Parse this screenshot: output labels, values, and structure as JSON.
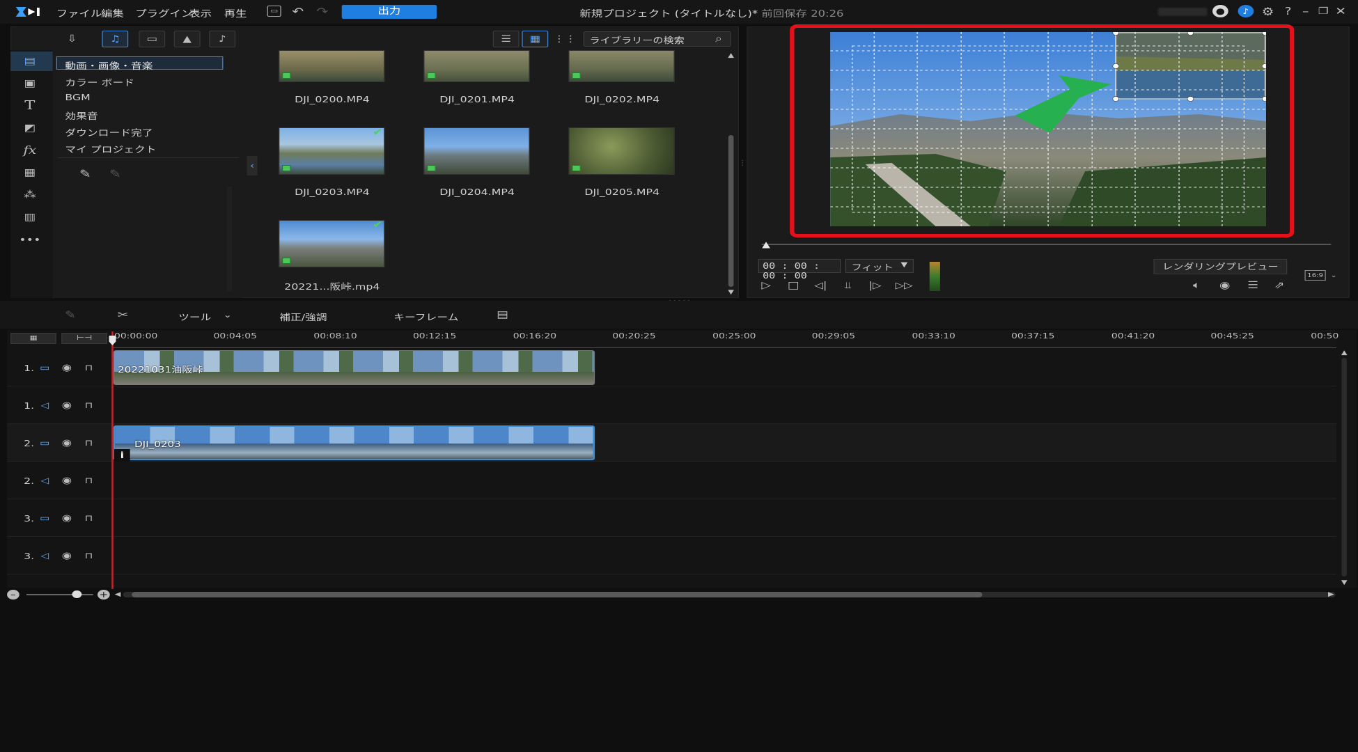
{
  "app": {
    "logo": "cyberlink-logo",
    "title": "新規プロジェクト (タイトルなし)*",
    "saved": "前回保存 20:26",
    "export": "出力"
  },
  "menu": [
    "ファイル",
    "編集",
    "プラグイン",
    "表示",
    "再生"
  ],
  "library": {
    "categories": [
      "動画・画像・音楽",
      "カラー ボード",
      "BGM",
      "効果音",
      "ダウンロード完了",
      "マイ プロジェクト"
    ],
    "search_placeholder": "ライブラリーの検索",
    "items": [
      {
        "name": "DJI_0200.MP4",
        "checked": false
      },
      {
        "name": "DJI_0201.MP4",
        "checked": false
      },
      {
        "name": "DJI_0202.MP4",
        "checked": false
      },
      {
        "name": "DJI_0203.MP4",
        "checked": true
      },
      {
        "name": "DJI_0204.MP4",
        "checked": false
      },
      {
        "name": "DJI_0205.MP4",
        "checked": false
      },
      {
        "name": "20221...阪峠.mp4",
        "checked": true
      }
    ]
  },
  "preview": {
    "timecode": "00 : 00 : 00 : 00",
    "zoom": "フィット",
    "render": "レンダリングプレビュー",
    "aspect": "16:9"
  },
  "edit_toolbar": {
    "tools": "ツール",
    "correct": "補正/強調",
    "keyframe": "キーフレーム"
  },
  "timeline": {
    "ticks": [
      "00:00:00",
      "00:04:05",
      "00:08:10",
      "00:12:15",
      "00:16:20",
      "00:20:25",
      "00:25:00",
      "00:29:05",
      "00:33:10",
      "00:37:15",
      "00:41:20",
      "00:45:25",
      "00:50"
    ],
    "tracks": [
      {
        "label": "1.",
        "kind": "video"
      },
      {
        "label": "1.",
        "kind": "audio"
      },
      {
        "label": "2.",
        "kind": "video"
      },
      {
        "label": "2.",
        "kind": "audio"
      },
      {
        "label": "3.",
        "kind": "video"
      },
      {
        "label": "3.",
        "kind": "audio"
      }
    ],
    "clips": {
      "main": "20221031油阪峠",
      "overlay": "DJI_0203"
    }
  },
  "colors": {
    "accent": "#1f7fe0",
    "highlight": "#e6101a",
    "arrow": "#27b04f",
    "playhead": "#c0252b"
  }
}
